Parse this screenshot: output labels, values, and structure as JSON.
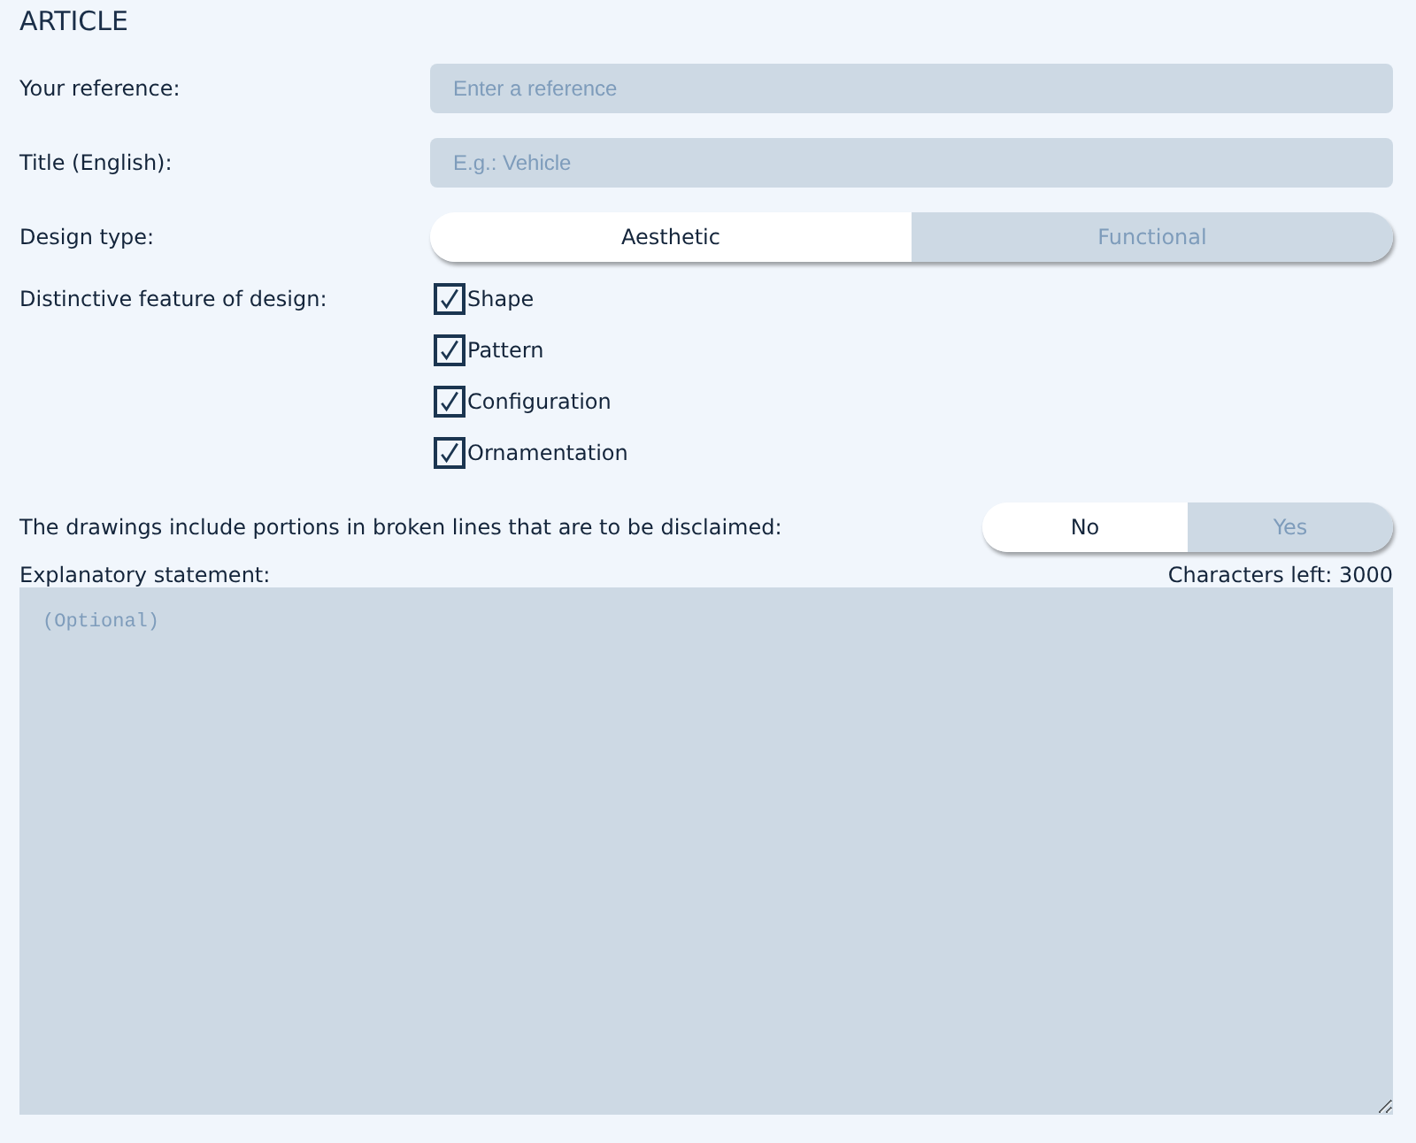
{
  "section_title": "ARTICLE",
  "fields": [
    {
      "label": "Your reference:",
      "placeholder": "Enter a reference"
    },
    {
      "label": "Title (English):",
      "placeholder": "E.g.: Vehicle"
    }
  ],
  "design_type": {
    "label": "Design type:",
    "options": [
      {
        "label": "Aesthetic",
        "selected": true
      },
      {
        "label": "Functional",
        "selected": false
      }
    ]
  },
  "distinctive_feature": {
    "label": "Distinctive feature of design:",
    "options": [
      {
        "label": "Shape",
        "checked": true
      },
      {
        "label": "Pattern",
        "checked": true
      },
      {
        "label": "Configuration",
        "checked": true
      },
      {
        "label": "Ornamentation",
        "checked": true
      }
    ]
  },
  "disclaimer": {
    "label": "The drawings include portions in broken lines that are to be disclaimed:",
    "options": [
      {
        "label": "No",
        "selected": true
      },
      {
        "label": "Yes",
        "selected": false
      }
    ]
  },
  "explanatory_statement": {
    "label": "Explanatory statement:",
    "counter": "Characters left: 3000",
    "placeholder": "(Optional)"
  }
}
